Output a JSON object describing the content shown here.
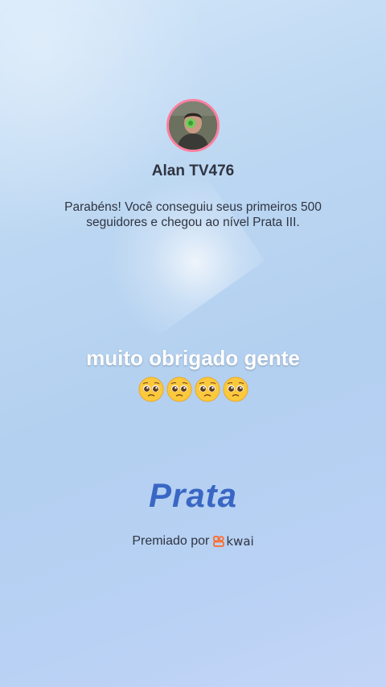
{
  "user": {
    "name": "Alan TV476",
    "avatar_icon": "avatar-photo"
  },
  "message": "Parabéns! Você conseguiu seus primeiros 500 seguidores e chegou ao nível Prata III.",
  "caption": "muito obrigado gente",
  "emojis": [
    "pleading-face-emoji",
    "pleading-face-emoji",
    "pleading-face-emoji",
    "pleading-face-emoji"
  ],
  "level": "Prata",
  "awarded": {
    "label": "Premiado por",
    "brand": "kwai",
    "brand_color": "#ff6a2b"
  },
  "colors": {
    "level_text": "#3a67c4",
    "avatar_ring": "#ff7fa0"
  }
}
